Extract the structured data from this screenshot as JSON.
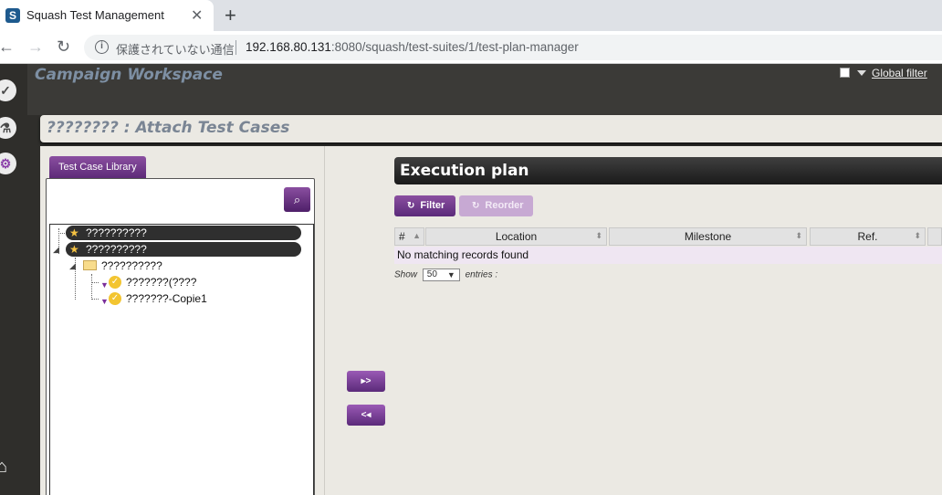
{
  "browser": {
    "tab_title": "Squash Test Management",
    "favicon": "S",
    "secure_text": "保護されていない通信",
    "url_host": "192.168.80.131",
    "url_rest": ":8080/squash/test-suites/1/test-plan-manager"
  },
  "workspace": {
    "title": "Campaign Workspace",
    "global_filter": "Global filter"
  },
  "page_title": "???????? : Attach Test Cases",
  "library": {
    "tab_label": "Test Case Library",
    "tree": [
      {
        "label": "??????????",
        "type": "project"
      },
      {
        "label": "??????????",
        "type": "project"
      },
      {
        "label": "??????????",
        "type": "folder"
      },
      {
        "label": "???????(????",
        "type": "test-case"
      },
      {
        "label": "???????-Copie1",
        "type": "test-case"
      }
    ]
  },
  "move_buttons": {
    "add": "▸>",
    "remove": "<◂"
  },
  "execution_plan": {
    "title": "Execution plan",
    "filter_label": "Filter",
    "reorder_label": "Reorder",
    "columns": [
      "#",
      "Location",
      "Milestone",
      "Ref."
    ],
    "empty_message": "No matching records found",
    "show_label": "Show",
    "entries_label": "entries :",
    "page_length": "50"
  }
}
